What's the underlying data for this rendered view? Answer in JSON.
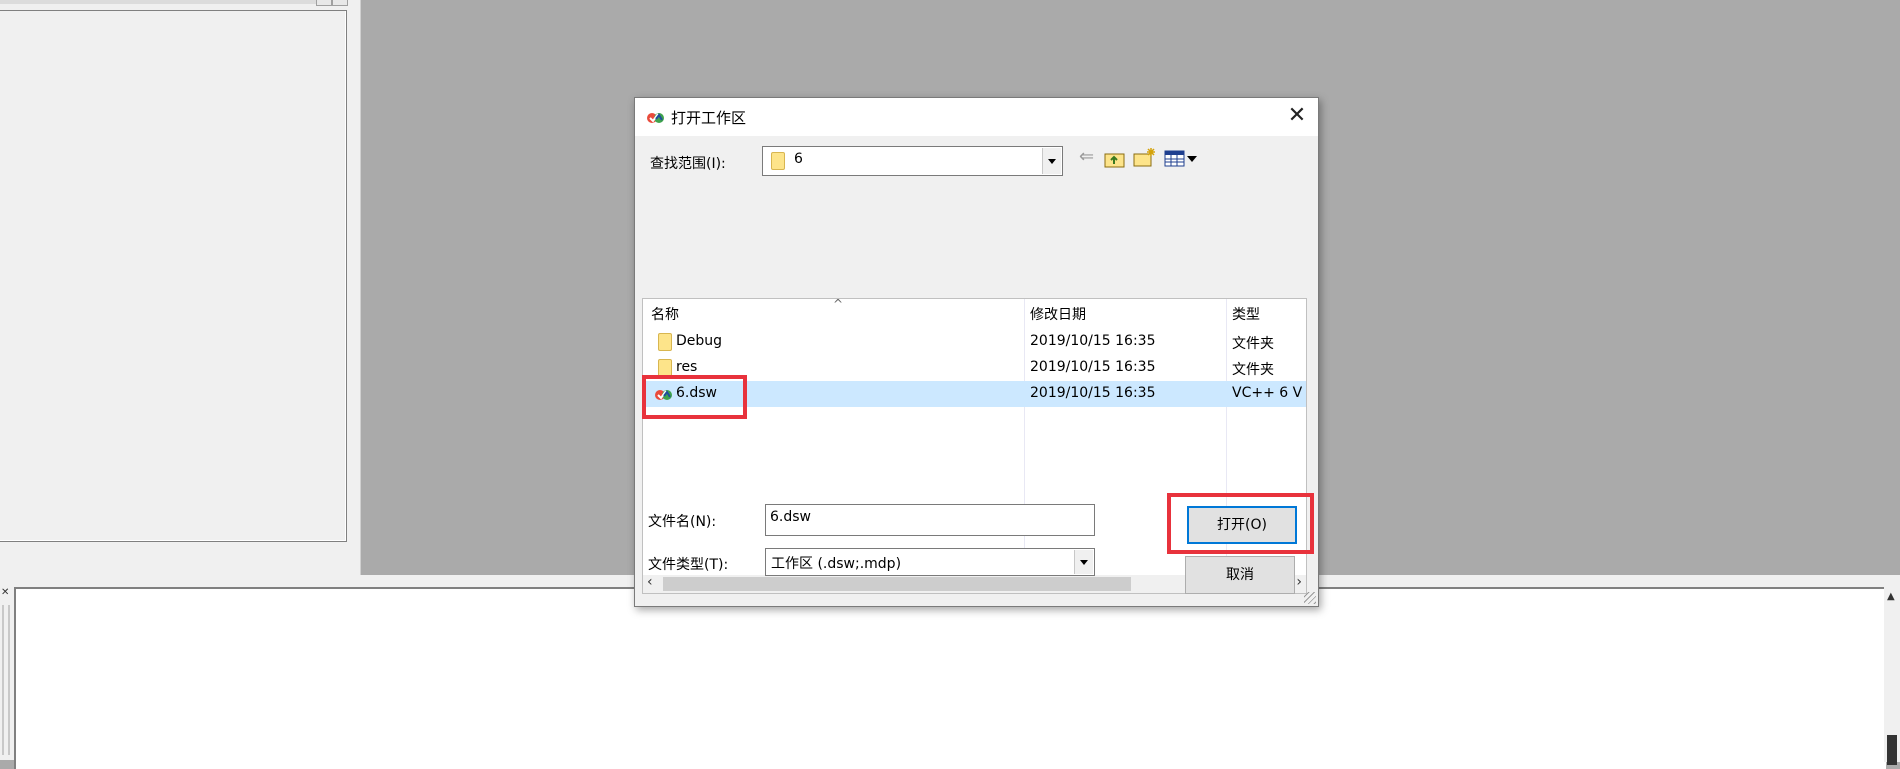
{
  "dialog": {
    "title": "打开工作区",
    "look_in_label": "查找范围(I):",
    "look_in_value": "6",
    "columns": {
      "name": "名称",
      "date": "修改日期",
      "type": "类型"
    },
    "files": [
      {
        "name": "Debug",
        "date": "2019/10/15 16:35",
        "type": "文件夹",
        "icon": "folder-icon"
      },
      {
        "name": "res",
        "date": "2019/10/15 16:35",
        "type": "文件夹",
        "icon": "folder-icon"
      },
      {
        "name": "6.dsw",
        "date": "2019/10/15 16:35",
        "type": "VC++ 6 V",
        "icon": "vc-workspace-icon",
        "selected": true
      }
    ],
    "filename_label": "文件名(N):",
    "filename_value": "6.dsw",
    "filetype_label": "文件类型(T):",
    "filetype_value": "工作区 (.dsw;.mdp)",
    "open_button": "打开(O)",
    "cancel_button": "取消"
  },
  "colors": {
    "selection": "#cce8ff",
    "highlight_box": "#e8323c",
    "desktop": "#aaaaaa"
  }
}
